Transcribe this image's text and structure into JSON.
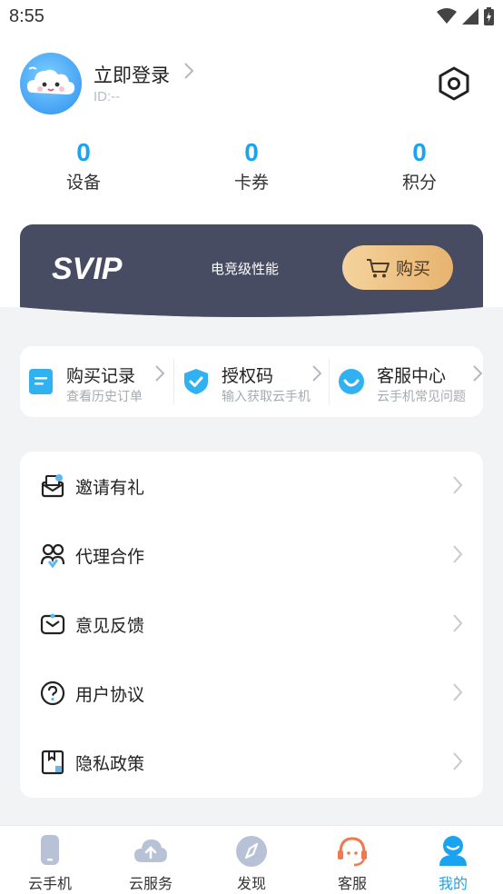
{
  "status_bar": {
    "time": "8:55"
  },
  "profile": {
    "login_label": "立即登录",
    "user_id": "ID:--"
  },
  "stats": [
    {
      "value": "0",
      "label": "设备"
    },
    {
      "value": "0",
      "label": "卡券"
    },
    {
      "value": "0",
      "label": "积分"
    }
  ],
  "svip": {
    "logo": "SVIP",
    "tagline": "电竞级性能",
    "buy_label": "购买",
    "colors": {
      "banner": "#474c63",
      "button": "#e7b36f"
    }
  },
  "shortcuts": [
    {
      "title": "购买记录",
      "subtitle": "查看历史订单",
      "icon": "document-icon"
    },
    {
      "title": "授权码",
      "subtitle": "输入获取云手机",
      "icon": "shield-check-icon"
    },
    {
      "title": "客服中心",
      "subtitle": "云手机常见问题",
      "icon": "smile-chat-icon"
    }
  ],
  "menu": [
    {
      "label": "邀请有礼",
      "icon": "invite-mail-icon"
    },
    {
      "label": "代理合作",
      "icon": "users-icon"
    },
    {
      "label": "意见反馈",
      "icon": "feedback-mail-icon"
    },
    {
      "label": "用户协议",
      "icon": "question-circle-icon"
    },
    {
      "label": "隐私政策",
      "icon": "bookmark-doc-icon"
    }
  ],
  "tabbar": {
    "active_index": 4,
    "accent_color": "#1aa3f0",
    "tabs": [
      {
        "label": "云手机",
        "icon": "phone-icon"
      },
      {
        "label": "云服务",
        "icon": "cloud-upload-icon"
      },
      {
        "label": "发现",
        "icon": "compass-icon"
      },
      {
        "label": "客服",
        "icon": "headset-icon"
      },
      {
        "label": "我的",
        "icon": "person-icon"
      }
    ]
  }
}
